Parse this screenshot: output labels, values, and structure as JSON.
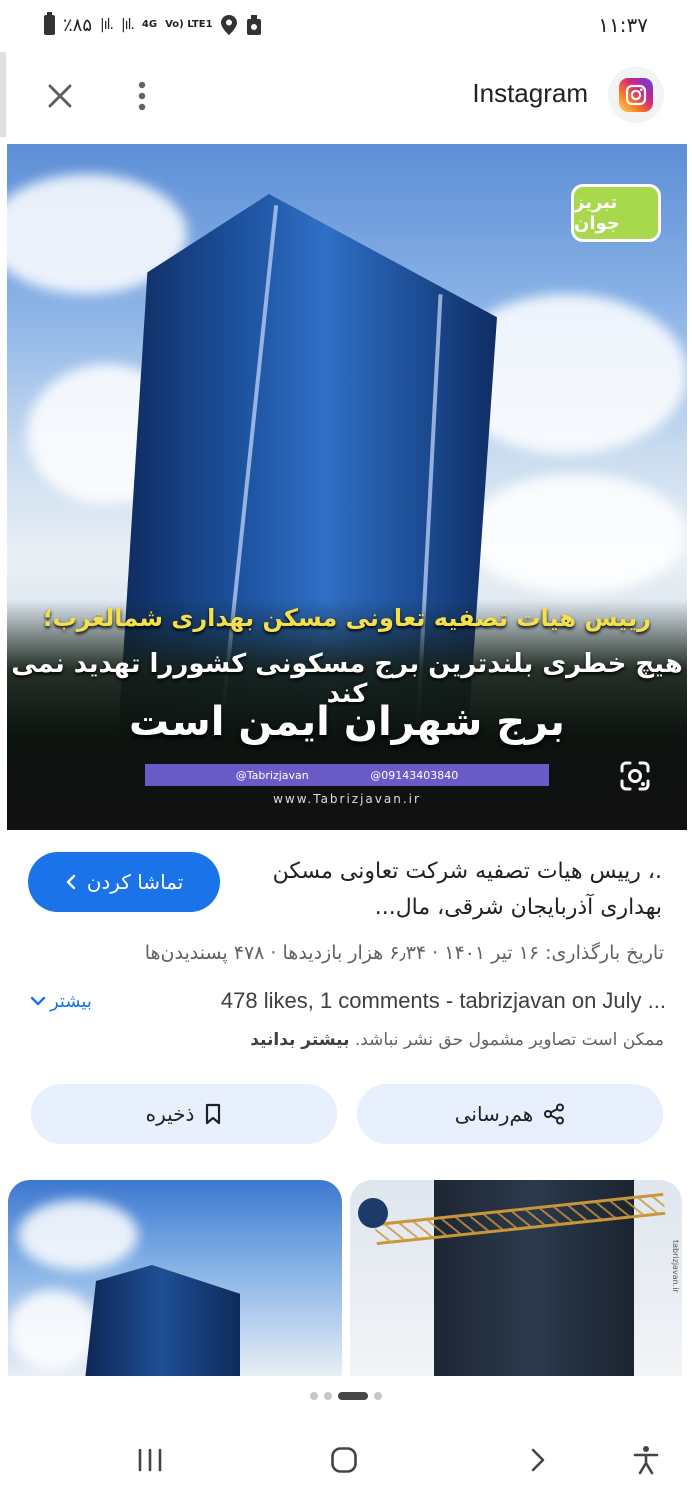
{
  "status_bar": {
    "battery": "٪۸۵",
    "network_4g": "4G",
    "volte": "Vo) LTE1",
    "time": "۱۱:۳۷"
  },
  "header": {
    "source_name": "Instagram",
    "close_icon": "close-icon",
    "more_icon": "more-vert-icon",
    "instagram_icon": "instagram-icon"
  },
  "image": {
    "headline_1": "رییس هیات تصفیه تعاونی مسکن بهداری شمالغرب؛",
    "headline_2": "هیچ خطری بلندترین برج مسکونی کشوررا تهدید نمی کند",
    "headline_3": "برج شهران ایمن است",
    "handle_1": "@Tabrizjavan",
    "handle_2": "@09143403840",
    "website": "www.Tabrizjavan.ir",
    "logo_text": "تبریز جوان"
  },
  "details": {
    "watch_label": "تماشا کردن",
    "title": ".، رییس هیات تصفیه شرکت تعاونی مسکن بهداری آذربایجان شرقی، مال...",
    "meta": "تاریخ بارگذاری: ۱۶ تیر ۱۴۰۱ · ۶٫۳۴ هزار بازدیدها · ۴۷۸ پسندیدن‌ها",
    "description": "478 likes, 1 comments - tabrizjavan on July ...",
    "more_label": "بیشتر",
    "copyright": "ممکن است تصاویر مشمول حق نشر نباشد.",
    "learn_more": "بیشتر بدانید"
  },
  "actions": {
    "share_label": "هم‌رسانی",
    "save_label": "ذخیره"
  },
  "related": {
    "right_thumb_watermark": "tabrizjavan.ir"
  },
  "colors": {
    "accent": "#1a73e8",
    "pill_bg": "#e8f0fe"
  }
}
